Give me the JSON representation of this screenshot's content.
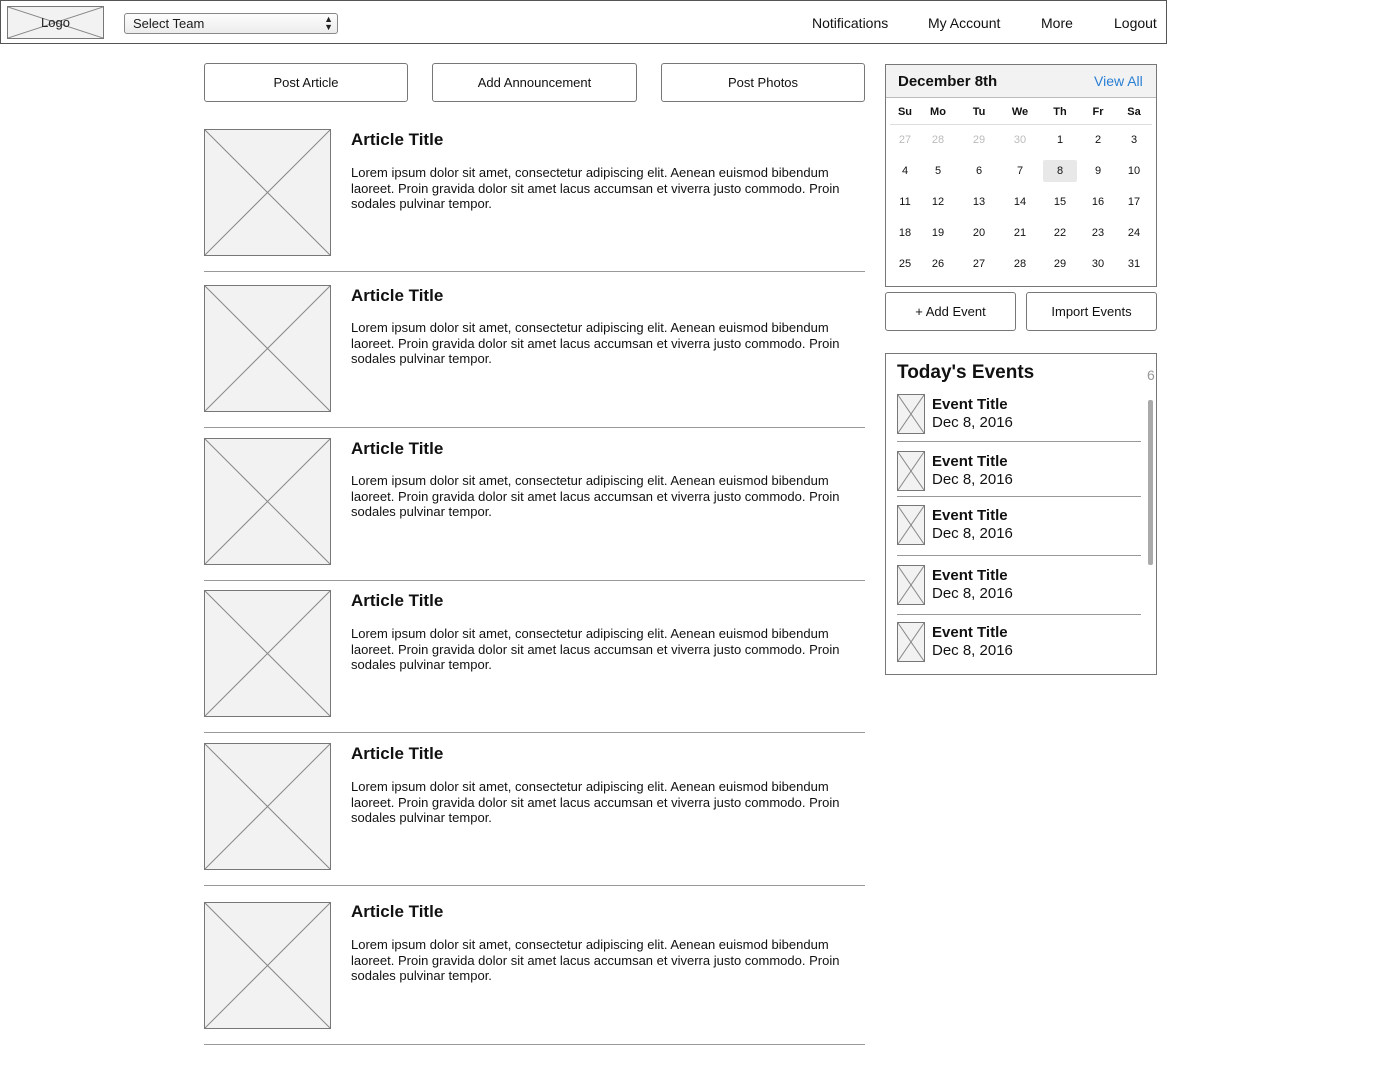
{
  "header": {
    "logo_label": "Logo",
    "team_select": "Select Team",
    "nav": [
      "Notifications",
      "My Account",
      "More",
      "Logout"
    ]
  },
  "actions": [
    "Post Article",
    "Add Announcement",
    "Post Photos"
  ],
  "articles": [
    {
      "title": "Article Title",
      "body": "Lorem ipsum dolor sit amet, consectetur adipiscing elit. Aenean euismod bibendum laoreet. Proin gravida dolor sit amet lacus accumsan et viverra justo commodo. Proin sodales pulvinar tempor."
    },
    {
      "title": "Article Title",
      "body": "Lorem ipsum dolor sit amet, consectetur adipiscing elit. Aenean euismod bibendum laoreet. Proin gravida dolor sit amet lacus accumsan et viverra justo commodo. Proin sodales pulvinar tempor."
    },
    {
      "title": "Article Title",
      "body": "Lorem ipsum dolor sit amet, consectetur adipiscing elit. Aenean euismod bibendum laoreet. Proin gravida dolor sit amet lacus accumsan et viverra justo commodo. Proin sodales pulvinar tempor."
    },
    {
      "title": "Article Title",
      "body": "Lorem ipsum dolor sit amet, consectetur adipiscing elit. Aenean euismod bibendum laoreet. Proin gravida dolor sit amet lacus accumsan et viverra justo commodo. Proin sodales pulvinar tempor."
    },
    {
      "title": "Article Title",
      "body": "Lorem ipsum dolor sit amet, consectetur adipiscing elit. Aenean euismod bibendum laoreet. Proin gravida dolor sit amet lacus accumsan et viverra justo commodo. Proin sodales pulvinar tempor."
    },
    {
      "title": "Article Title",
      "body": "Lorem ipsum dolor sit amet, consectetur adipiscing elit. Aenean euismod bibendum laoreet. Proin gravida dolor sit amet lacus accumsan et viverra justo commodo. Proin sodales pulvinar tempor."
    }
  ],
  "calendar": {
    "month_label": "December 8th",
    "view_all": "View All",
    "weekdays": [
      "Su",
      "Mo",
      "Tu",
      "We",
      "Th",
      "Fr",
      "Sa"
    ],
    "weeks": [
      [
        "27",
        "28",
        "29",
        "30",
        "1",
        "2",
        "3"
      ],
      [
        "4",
        "5",
        "6",
        "7",
        "8",
        "9",
        "10"
      ],
      [
        "11",
        "12",
        "13",
        "14",
        "15",
        "16",
        "17"
      ],
      [
        "18",
        "19",
        "20",
        "21",
        "22",
        "23",
        "24"
      ],
      [
        "25",
        "26",
        "27",
        "28",
        "29",
        "30",
        "31"
      ]
    ],
    "muted_days": [
      "27",
      "28",
      "29",
      "30"
    ],
    "selected_day": "8",
    "accent_color": "#2a7fd4"
  },
  "calendar_actions": [
    "+ Add Event",
    "Import Events"
  ],
  "events": {
    "title": "Today's Events",
    "count": "6",
    "items": [
      {
        "title": "Event Title",
        "date": "Dec 8, 2016"
      },
      {
        "title": "Event Title",
        "date": "Dec 8, 2016"
      },
      {
        "title": "Event Title",
        "date": "Dec 8, 2016"
      },
      {
        "title": "Event Title",
        "date": "Dec 8, 2016"
      },
      {
        "title": "Event Title",
        "date": "Dec 8, 2016"
      }
    ]
  }
}
